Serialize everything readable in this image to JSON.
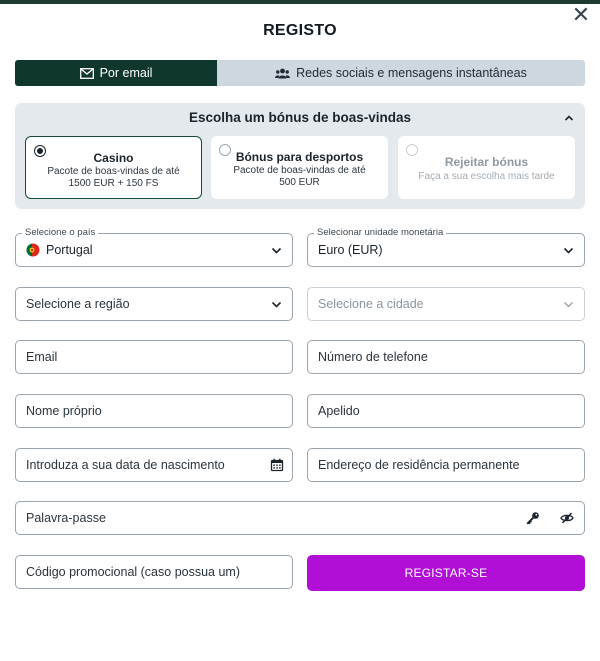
{
  "dialog": {
    "title": "REGISTO",
    "close_glyph": "✕"
  },
  "tabs": [
    {
      "label": "Por email",
      "icon": "envelope-icon",
      "active": true
    },
    {
      "label": "Redes sociais e mensagens instantâneas",
      "icon": "users-icon",
      "active": false
    }
  ],
  "bonus": {
    "title": "Escolha um bónus de boas-vindas",
    "options": [
      {
        "title": "Casino",
        "desc1": "Pacote de boas-vindas de até",
        "desc2": "1500 EUR + 150 FS",
        "selected": true
      },
      {
        "title": "Bónus para desportos",
        "desc1": "Pacote de boas-vindas de até",
        "desc2": "500 EUR",
        "selected": false
      },
      {
        "title": "Rejeitar bónus",
        "desc1": "Faça a sua escolha mais tarde",
        "desc2": "",
        "selected": false
      }
    ]
  },
  "form": {
    "country": {
      "label": "Selecione o país",
      "value": "Portugal"
    },
    "currency": {
      "label": "Selecionar unidade monetária",
      "value": "Euro (EUR)"
    },
    "region": {
      "placeholder": "Selecione a região"
    },
    "city": {
      "placeholder": "Selecione a cidade"
    },
    "email": {
      "placeholder": "Email"
    },
    "phone": {
      "placeholder": "Número de telefone"
    },
    "first_name": {
      "placeholder": "Nome próprio"
    },
    "last_name": {
      "placeholder": "Apelido"
    },
    "birth_date": {
      "placeholder": "Introduza a sua data de nascimento"
    },
    "address": {
      "placeholder": "Endereço de residência permanente"
    },
    "password": {
      "placeholder": "Palavra-passe"
    },
    "promo": {
      "placeholder": "Código promocional (caso possua um)"
    },
    "submit_label": "REGISTAR-SE"
  },
  "colors": {
    "primary_dark_green": "#10372d",
    "submit_purple": "#b10ed6",
    "panel_gray": "#e4e9ee"
  }
}
